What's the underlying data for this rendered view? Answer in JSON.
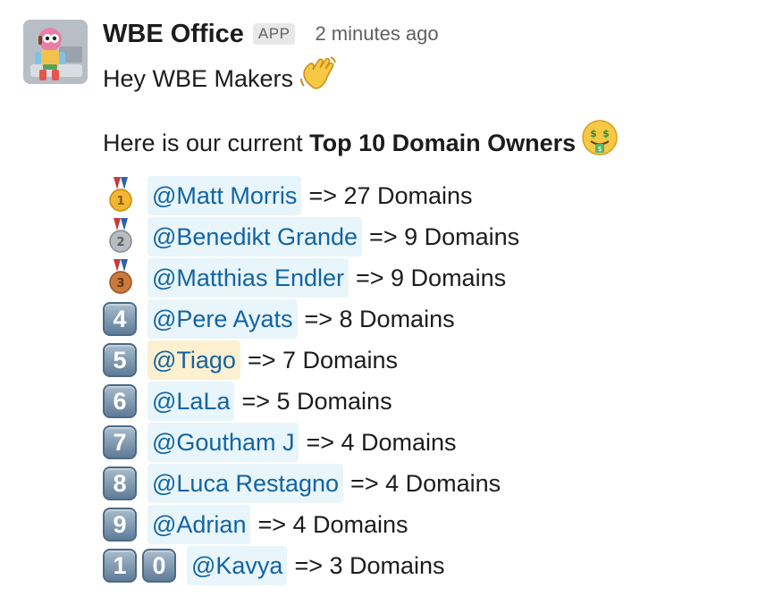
{
  "message": {
    "sender": "WBE Office",
    "badge": "APP",
    "timestamp": "2 minutes ago",
    "greeting": "Hey WBE Makers",
    "intro_prefix": "Here is our current ",
    "intro_bold": "Top 10 Domain Owners"
  },
  "leaderboard": [
    {
      "rank_icon": "gold-medal-icon",
      "name": "@Matt Morris",
      "text": "=> 27 Domains"
    },
    {
      "rank_icon": "silver-medal-icon",
      "name": "@Benedikt Grande",
      "text": "=> 9 Domains"
    },
    {
      "rank_icon": "bronze-medal-icon",
      "name": "@Matthias Endler",
      "text": "=> 9 Domains"
    },
    {
      "rank_icon": "keycap-4-icon",
      "digit": "4",
      "name": "@Pere Ayats",
      "text": "=> 8 Domains"
    },
    {
      "rank_icon": "keycap-5-icon",
      "digit": "5",
      "name": "@Tiago",
      "text": "=> 7 Domains"
    },
    {
      "rank_icon": "keycap-6-icon",
      "digit": "6",
      "name": "@LaLa",
      "text": "=> 5 Domains"
    },
    {
      "rank_icon": "keycap-7-icon",
      "digit": "7",
      "name": "@Goutham J",
      "text": "=> 4 Domains"
    },
    {
      "rank_icon": "keycap-8-icon",
      "digit": "8",
      "name": "@Luca Restagno",
      "text": "=> 4 Domains"
    },
    {
      "rank_icon": "keycap-9-icon",
      "digit": "9",
      "name": "@Adrian",
      "text": "=> 4 Domains"
    },
    {
      "rank_icon": "keycap-1-0-icon",
      "digit": "1",
      "digit2": "0",
      "name": "@Kavya",
      "text": "=> 3 Domains"
    }
  ],
  "colors": {
    "mention_bg": "#e8f5fa",
    "mention_text": "#1264a3",
    "self_mention_bg": "#fcf0d1",
    "keycap": "#5e7c98"
  }
}
